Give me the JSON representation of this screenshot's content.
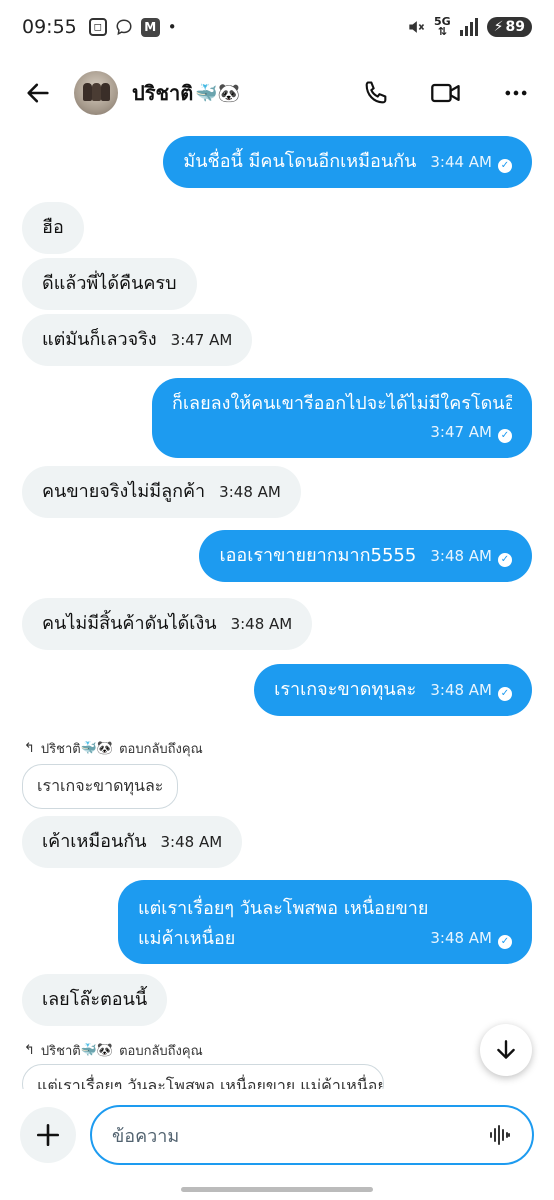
{
  "status_bar": {
    "time": "09:55",
    "network": "5G",
    "battery": "89"
  },
  "header": {
    "contact_name": "ปริชาติ",
    "name_emojis": "🐳🐼"
  },
  "messages": [
    {
      "side": "out",
      "text": "มันชื่อนี้ มีคนโดนอีกเหมือนกัน",
      "time": "3:44 AM"
    },
    {
      "side": "in",
      "text": "ฮือ",
      "time": ""
    },
    {
      "side": "in",
      "text": "ดีแล้วพี่ได้คืนครบ",
      "time": ""
    },
    {
      "side": "in",
      "text": "แต่มันก็เลวจริง",
      "time": "3:47 AM"
    },
    {
      "side": "out",
      "text": "ก็เลยลงให้คนเขารีออกไปจะได้ไม่มีใครโดนอีก",
      "time": "3:47 AM"
    },
    {
      "side": "in",
      "text": "คนขายจริงไม่มีลูกค้า",
      "time": "3:48 AM"
    },
    {
      "side": "out",
      "text": "เออเราขายยากมาก5555",
      "time": "3:48 AM"
    },
    {
      "side": "in",
      "text": "คนไม่มีสิ้นค้าดันได้เงิน",
      "time": "3:48 AM"
    },
    {
      "side": "out",
      "text": "เราเกจะขาดทุนละ",
      "time": "3:48 AM"
    },
    {
      "side": "in",
      "text": "เค้าเหมือนกัน",
      "time": "3:48 AM"
    },
    {
      "side": "out",
      "text": "แต่เราเรื่อยๆ วันละโพสพอ เหนื่อยขาย แม่ค้าเหนื่อย",
      "time": "3:48 AM"
    },
    {
      "side": "in",
      "text": "เลยโล๊ะตอนนี้",
      "time": ""
    }
  ],
  "replies": [
    {
      "label_name": "ปริชาติ",
      "label_emojis": "🐳🐼",
      "label_suffix": "ตอบกลับถึงคุณ",
      "quote": "เราเกจะขาดทุนละ"
    },
    {
      "label_name": "ปริชาติ",
      "label_emojis": "🐳🐼",
      "label_suffix": "ตอบกลับถึงคุณ",
      "quote": "แต่เราเรื่อยๆ วันละโพสพอ เหนื่อยขาย แม่ค้าเหนื่อย"
    }
  ],
  "composer": {
    "placeholder": "ข้อความ"
  },
  "colors": {
    "accent": "#1d9bf0",
    "incoming_bubble": "#eff3f4"
  },
  "icons": {
    "back": "arrow-left-icon",
    "call": "phone-icon",
    "video": "video-camera-icon",
    "more": "more-horizontal-icon",
    "scroll": "arrow-down-icon",
    "add": "plus-icon",
    "voice": "waveform-icon"
  }
}
